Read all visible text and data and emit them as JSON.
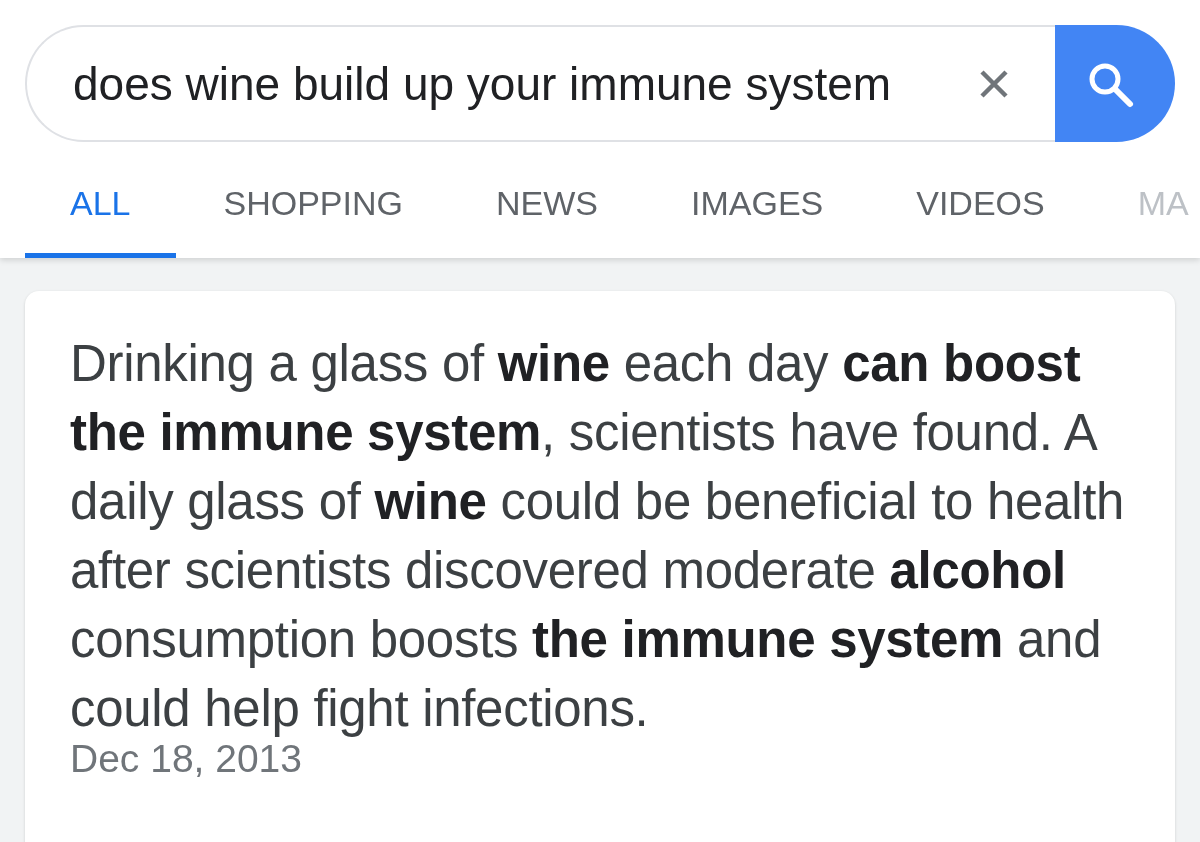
{
  "search": {
    "value": "does wine build up your immune system"
  },
  "tabs": [
    {
      "label": "ALL",
      "selected": true
    },
    {
      "label": "SHOPPING",
      "selected": false
    },
    {
      "label": "NEWS",
      "selected": false
    },
    {
      "label": "IMAGES",
      "selected": false
    },
    {
      "label": "VIDEOS",
      "selected": false
    },
    {
      "label": "MA",
      "selected": false
    }
  ],
  "snippet": {
    "text": "Drinking a glass of **wine** each day **can boost the immune system**, scientists have found. A daily glass of **wine** could be beneficial to health after scientists discovered moderate **alcohol** consumption boosts **the immune system** and could help fight infections.",
    "date": "Dec 18, 2013"
  }
}
